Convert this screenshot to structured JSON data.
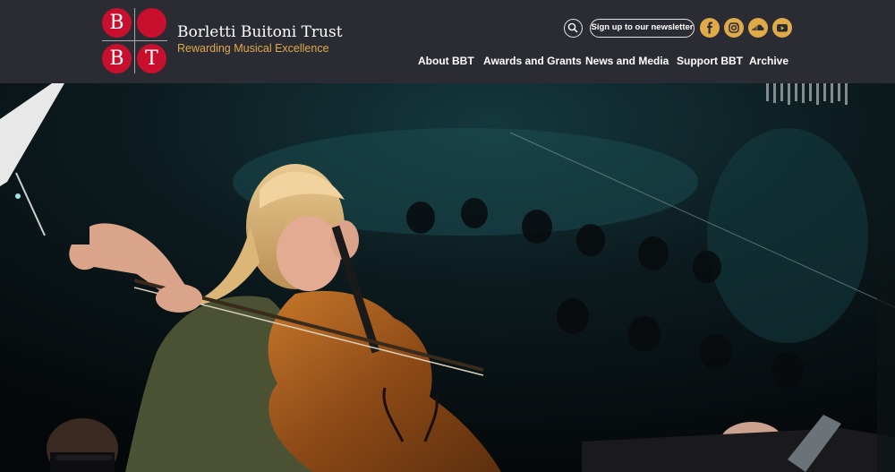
{
  "brand": {
    "logo_letters": [
      "B",
      "B",
      "T"
    ],
    "name": "Borletti Buitoni Trust",
    "tagline": "Rewarding Musical Excellence"
  },
  "header": {
    "newsletter_label": "Sign up to our newsletter",
    "social_icons": [
      "facebook-icon",
      "instagram-icon",
      "soundcloud-icon",
      "youtube-icon"
    ]
  },
  "nav": {
    "items": [
      {
        "label": "About BBT"
      },
      {
        "label": "Awards and Grants"
      },
      {
        "label": "News and Media"
      },
      {
        "label": "Support BBT"
      },
      {
        "label": "Archive"
      }
    ]
  },
  "colors": {
    "header_bg": "#2b2c33",
    "logo_red": "#c8102e",
    "accent_gold": "#e0a94a"
  }
}
